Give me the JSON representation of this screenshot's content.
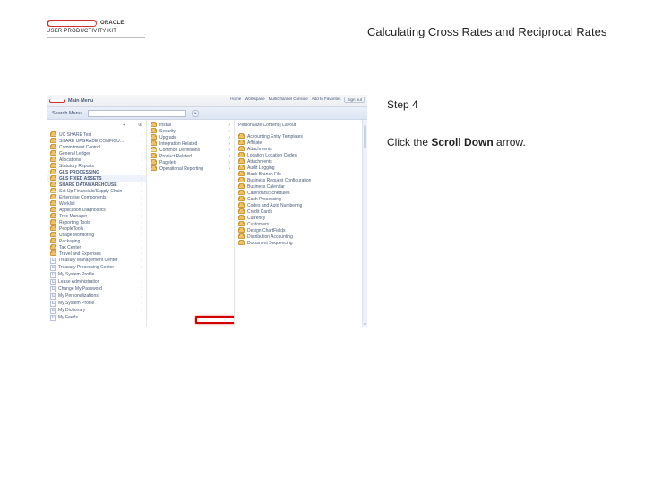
{
  "brand": {
    "name": "ORACLE",
    "subtitle": "USER PRODUCTIVITY KIT"
  },
  "page_title": "Calculating Cross Rates and Reciprocal Rates",
  "instruction": {
    "step_label": "Step 4",
    "prefix": "Click the ",
    "bold": "Scroll Down",
    "suffix": " arrow."
  },
  "screenshot": {
    "main_menu_label": "Main Menu",
    "top_links": [
      "Home",
      "Workspace",
      "MultiChannel Console",
      "Add to Favorites",
      "Sign out"
    ],
    "search_label": "Search Menu:",
    "search_placeholder": "",
    "personalize_label": "Personalize Content | Layout",
    "col1_items": [
      {
        "icon": "folder",
        "label": "UC SHARE Test"
      },
      {
        "icon": "folder",
        "label": "SHARE UPGRADE CONFIGU…"
      },
      {
        "icon": "folder",
        "label": "Commitment Control"
      },
      {
        "icon": "folder",
        "label": "General Ledger"
      },
      {
        "icon": "folder",
        "label": "Allocations"
      },
      {
        "icon": "folder",
        "label": "Statutory Reports"
      },
      {
        "icon": "folder",
        "label": "GLS PROCESSING",
        "strong": true
      },
      {
        "icon": "folder",
        "label": "GLS FIXED ASSETS",
        "strong": true,
        "highlight": true
      },
      {
        "icon": "folder",
        "label": "SHARE DATAWAREHOUSE",
        "strong": true
      },
      {
        "icon": "folder",
        "label": "Set Up Financials/Supply Chain",
        "selected": true
      },
      {
        "icon": "folder",
        "label": "Enterprise Components"
      },
      {
        "icon": "folder",
        "label": "Worklist"
      },
      {
        "icon": "folder",
        "label": "Application Diagnostics"
      },
      {
        "icon": "folder",
        "label": "Tree Manager"
      },
      {
        "icon": "folder",
        "label": "Reporting Tools"
      },
      {
        "icon": "folder",
        "label": "PeopleTools"
      },
      {
        "icon": "folder",
        "label": "Usage Monitoring"
      },
      {
        "icon": "folder",
        "label": "Packaging"
      },
      {
        "icon": "folder",
        "label": "Tax Center"
      },
      {
        "icon": "folder",
        "label": "Travel and Expenses"
      },
      {
        "icon": "doc",
        "label": "Treasury Management Center"
      },
      {
        "icon": "doc",
        "label": "Treasury Processing Center"
      },
      {
        "icon": "doc",
        "label": "My System Profile"
      },
      {
        "icon": "doc",
        "label": "Lease Administration"
      },
      {
        "icon": "doc",
        "label": "Change My Password"
      },
      {
        "icon": "doc",
        "label": "My Personalizations"
      },
      {
        "icon": "doc",
        "label": "My System Profile"
      },
      {
        "icon": "doc",
        "label": "My Dictionary"
      },
      {
        "icon": "doc",
        "label": "My Feeds"
      }
    ],
    "col2_items": [
      {
        "icon": "folder",
        "label": "Install"
      },
      {
        "icon": "folder",
        "label": "Security"
      },
      {
        "icon": "folder",
        "label": "Upgrade"
      },
      {
        "icon": "folder",
        "label": "Integration Related"
      },
      {
        "icon": "folder",
        "label": "Common Definitions",
        "selected": true
      },
      {
        "icon": "folder",
        "label": "Product Related"
      },
      {
        "icon": "folder",
        "label": "Pagelets"
      },
      {
        "icon": "folder",
        "label": "Operational Reporting"
      }
    ],
    "col3_items": [
      {
        "icon": "folder",
        "label": "Accounting Entry Templates"
      },
      {
        "icon": "folder",
        "label": "Affiliate"
      },
      {
        "icon": "folder",
        "label": "Attachments"
      },
      {
        "icon": "folder",
        "label": "Location Location Codes"
      },
      {
        "icon": "folder",
        "label": "Attachments"
      },
      {
        "icon": "folder",
        "label": "Audit Logging"
      },
      {
        "icon": "folder",
        "label": "Bank Branch File"
      },
      {
        "icon": "folder",
        "label": "Business Request Configuration"
      },
      {
        "icon": "folder",
        "label": "Business Calendar"
      },
      {
        "icon": "folder",
        "label": "Calendars/Schedules"
      },
      {
        "icon": "folder",
        "label": "Cash Processing"
      },
      {
        "icon": "folder",
        "label": "Codes and Auto Numbering"
      },
      {
        "icon": "folder",
        "label": "Credit Cards"
      },
      {
        "icon": "folder",
        "label": "Currency"
      },
      {
        "icon": "folder",
        "label": "Customers"
      },
      {
        "icon": "folder",
        "label": "Design ChartFields"
      },
      {
        "icon": "folder",
        "label": "Distribution Accounting"
      },
      {
        "icon": "folder",
        "label": "Document Sequencing"
      }
    ]
  }
}
